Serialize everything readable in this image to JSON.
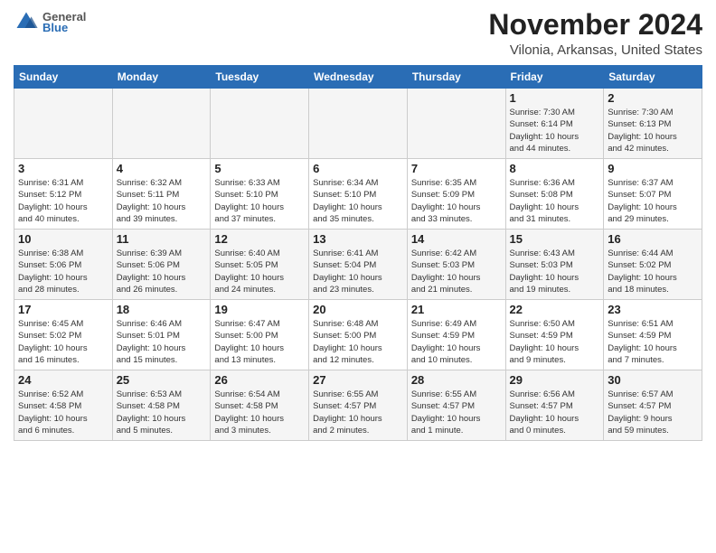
{
  "header": {
    "logo_general": "General",
    "logo_blue": "Blue",
    "month_year": "November 2024",
    "location": "Vilonia, Arkansas, United States"
  },
  "days_of_week": [
    "Sunday",
    "Monday",
    "Tuesday",
    "Wednesday",
    "Thursday",
    "Friday",
    "Saturday"
  ],
  "weeks": [
    [
      {
        "day": "",
        "info": ""
      },
      {
        "day": "",
        "info": ""
      },
      {
        "day": "",
        "info": ""
      },
      {
        "day": "",
        "info": ""
      },
      {
        "day": "",
        "info": ""
      },
      {
        "day": "1",
        "info": "Sunrise: 7:30 AM\nSunset: 6:14 PM\nDaylight: 10 hours\nand 44 minutes."
      },
      {
        "day": "2",
        "info": "Sunrise: 7:30 AM\nSunset: 6:13 PM\nDaylight: 10 hours\nand 42 minutes."
      }
    ],
    [
      {
        "day": "3",
        "info": "Sunrise: 6:31 AM\nSunset: 5:12 PM\nDaylight: 10 hours\nand 40 minutes."
      },
      {
        "day": "4",
        "info": "Sunrise: 6:32 AM\nSunset: 5:11 PM\nDaylight: 10 hours\nand 39 minutes."
      },
      {
        "day": "5",
        "info": "Sunrise: 6:33 AM\nSunset: 5:10 PM\nDaylight: 10 hours\nand 37 minutes."
      },
      {
        "day": "6",
        "info": "Sunrise: 6:34 AM\nSunset: 5:10 PM\nDaylight: 10 hours\nand 35 minutes."
      },
      {
        "day": "7",
        "info": "Sunrise: 6:35 AM\nSunset: 5:09 PM\nDaylight: 10 hours\nand 33 minutes."
      },
      {
        "day": "8",
        "info": "Sunrise: 6:36 AM\nSunset: 5:08 PM\nDaylight: 10 hours\nand 31 minutes."
      },
      {
        "day": "9",
        "info": "Sunrise: 6:37 AM\nSunset: 5:07 PM\nDaylight: 10 hours\nand 29 minutes."
      }
    ],
    [
      {
        "day": "10",
        "info": "Sunrise: 6:38 AM\nSunset: 5:06 PM\nDaylight: 10 hours\nand 28 minutes."
      },
      {
        "day": "11",
        "info": "Sunrise: 6:39 AM\nSunset: 5:06 PM\nDaylight: 10 hours\nand 26 minutes."
      },
      {
        "day": "12",
        "info": "Sunrise: 6:40 AM\nSunset: 5:05 PM\nDaylight: 10 hours\nand 24 minutes."
      },
      {
        "day": "13",
        "info": "Sunrise: 6:41 AM\nSunset: 5:04 PM\nDaylight: 10 hours\nand 23 minutes."
      },
      {
        "day": "14",
        "info": "Sunrise: 6:42 AM\nSunset: 5:03 PM\nDaylight: 10 hours\nand 21 minutes."
      },
      {
        "day": "15",
        "info": "Sunrise: 6:43 AM\nSunset: 5:03 PM\nDaylight: 10 hours\nand 19 minutes."
      },
      {
        "day": "16",
        "info": "Sunrise: 6:44 AM\nSunset: 5:02 PM\nDaylight: 10 hours\nand 18 minutes."
      }
    ],
    [
      {
        "day": "17",
        "info": "Sunrise: 6:45 AM\nSunset: 5:02 PM\nDaylight: 10 hours\nand 16 minutes."
      },
      {
        "day": "18",
        "info": "Sunrise: 6:46 AM\nSunset: 5:01 PM\nDaylight: 10 hours\nand 15 minutes."
      },
      {
        "day": "19",
        "info": "Sunrise: 6:47 AM\nSunset: 5:00 PM\nDaylight: 10 hours\nand 13 minutes."
      },
      {
        "day": "20",
        "info": "Sunrise: 6:48 AM\nSunset: 5:00 PM\nDaylight: 10 hours\nand 12 minutes."
      },
      {
        "day": "21",
        "info": "Sunrise: 6:49 AM\nSunset: 4:59 PM\nDaylight: 10 hours\nand 10 minutes."
      },
      {
        "day": "22",
        "info": "Sunrise: 6:50 AM\nSunset: 4:59 PM\nDaylight: 10 hours\nand 9 minutes."
      },
      {
        "day": "23",
        "info": "Sunrise: 6:51 AM\nSunset: 4:59 PM\nDaylight: 10 hours\nand 7 minutes."
      }
    ],
    [
      {
        "day": "24",
        "info": "Sunrise: 6:52 AM\nSunset: 4:58 PM\nDaylight: 10 hours\nand 6 minutes."
      },
      {
        "day": "25",
        "info": "Sunrise: 6:53 AM\nSunset: 4:58 PM\nDaylight: 10 hours\nand 5 minutes."
      },
      {
        "day": "26",
        "info": "Sunrise: 6:54 AM\nSunset: 4:58 PM\nDaylight: 10 hours\nand 3 minutes."
      },
      {
        "day": "27",
        "info": "Sunrise: 6:55 AM\nSunset: 4:57 PM\nDaylight: 10 hours\nand 2 minutes."
      },
      {
        "day": "28",
        "info": "Sunrise: 6:55 AM\nSunset: 4:57 PM\nDaylight: 10 hours\nand 1 minute."
      },
      {
        "day": "29",
        "info": "Sunrise: 6:56 AM\nSunset: 4:57 PM\nDaylight: 10 hours\nand 0 minutes."
      },
      {
        "day": "30",
        "info": "Sunrise: 6:57 AM\nSunset: 4:57 PM\nDaylight: 9 hours\nand 59 minutes."
      }
    ]
  ]
}
